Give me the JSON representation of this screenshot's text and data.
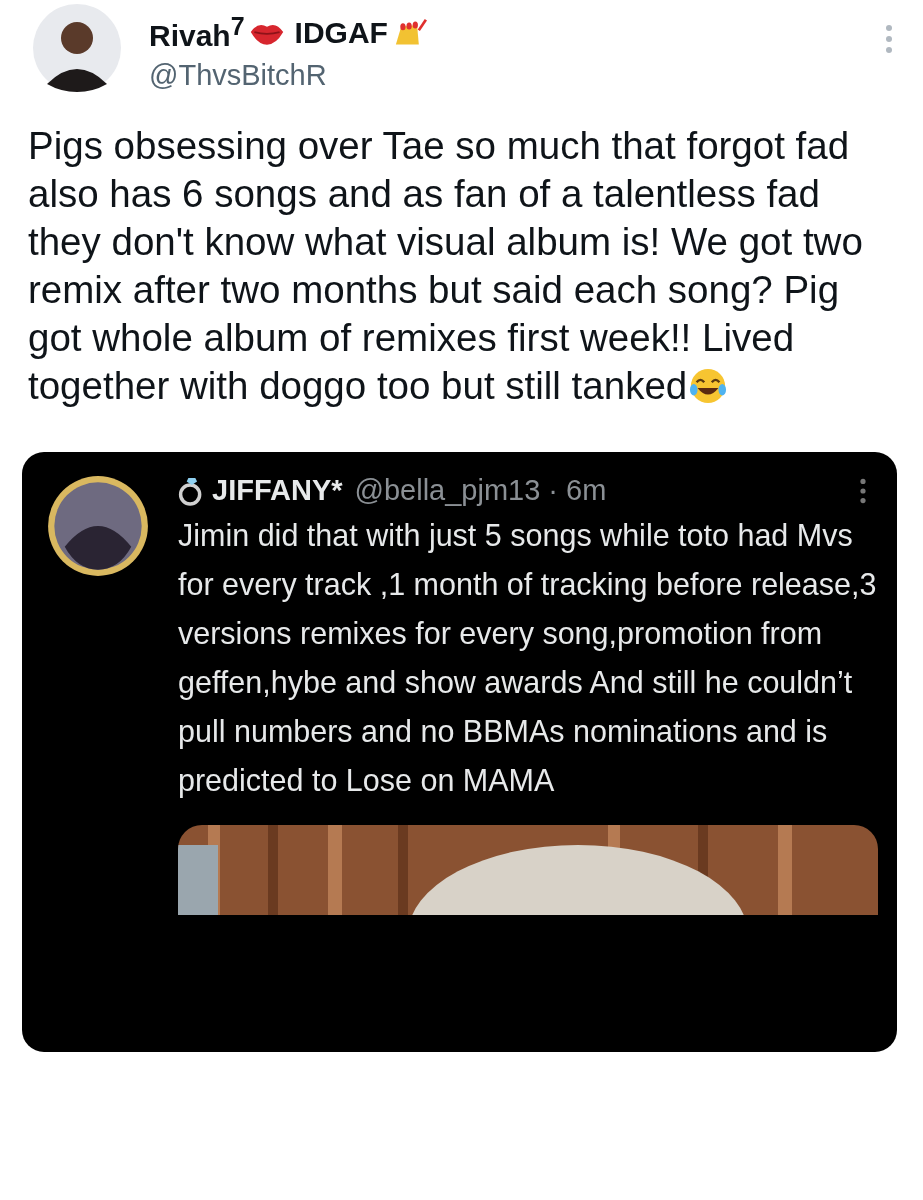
{
  "author": {
    "name": "Rivah$^{7}$",
    "name_suffix": "IDGAF",
    "handle": "@ThvsBitchR"
  },
  "text": "Pigs obsessing over Tae so much that forgot fad also has 6 songs and as fan of a talentless fad they don't know what visual album is! We got two remix after two months but said each song? Pig got whole album of remixes first week!! Lived together with doggo too but still tanked",
  "quoted": {
    "author": {
      "name": "JIFFANY*",
      "handle": "@bella_pjm13",
      "separator": "·",
      "time": "6m"
    },
    "text": "Jimin did that with just 5 songs while toto had Mvs for every track ,1 month of tracking before release,3 versions remixes for every song,promotion from geffen,hybe and show awards And still he couldn’t pull numbers and no BBMAs nominations and is predicted to Lose on MAMA"
  }
}
